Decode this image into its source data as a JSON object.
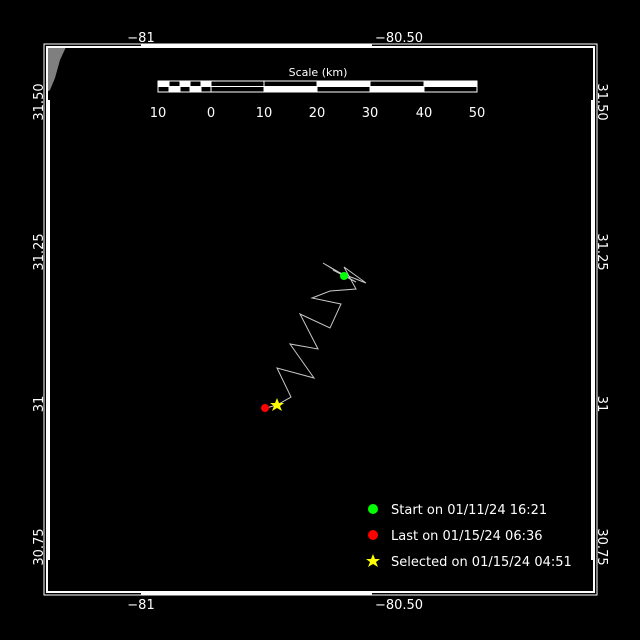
{
  "map": {
    "colors": {
      "background": "#000000",
      "frame": "#ffffff",
      "track": "#c8c8c8",
      "land": "#7f7f7f",
      "start": "#00ff00",
      "last": "#ff0000",
      "selected": "#ffff00"
    },
    "lon_ticks": [
      "−81",
      "−80.50"
    ],
    "lat_ticks": [
      "31.50",
      "31.25",
      "31",
      "30.75"
    ],
    "scale_bar": {
      "title": "Scale (km)",
      "labels": [
        "10",
        "0",
        "10",
        "20",
        "30",
        "40",
        "50"
      ]
    },
    "legend": [
      {
        "marker": "circle",
        "color": "#00ff00",
        "text": "Start on 01/11/24 16:21"
      },
      {
        "marker": "circle",
        "color": "#ff0000",
        "text": "Last on 01/15/24 06:36"
      },
      {
        "marker": "star",
        "color": "#ffff00",
        "text": "Selected on 01/15/24 04:51"
      }
    ]
  }
}
